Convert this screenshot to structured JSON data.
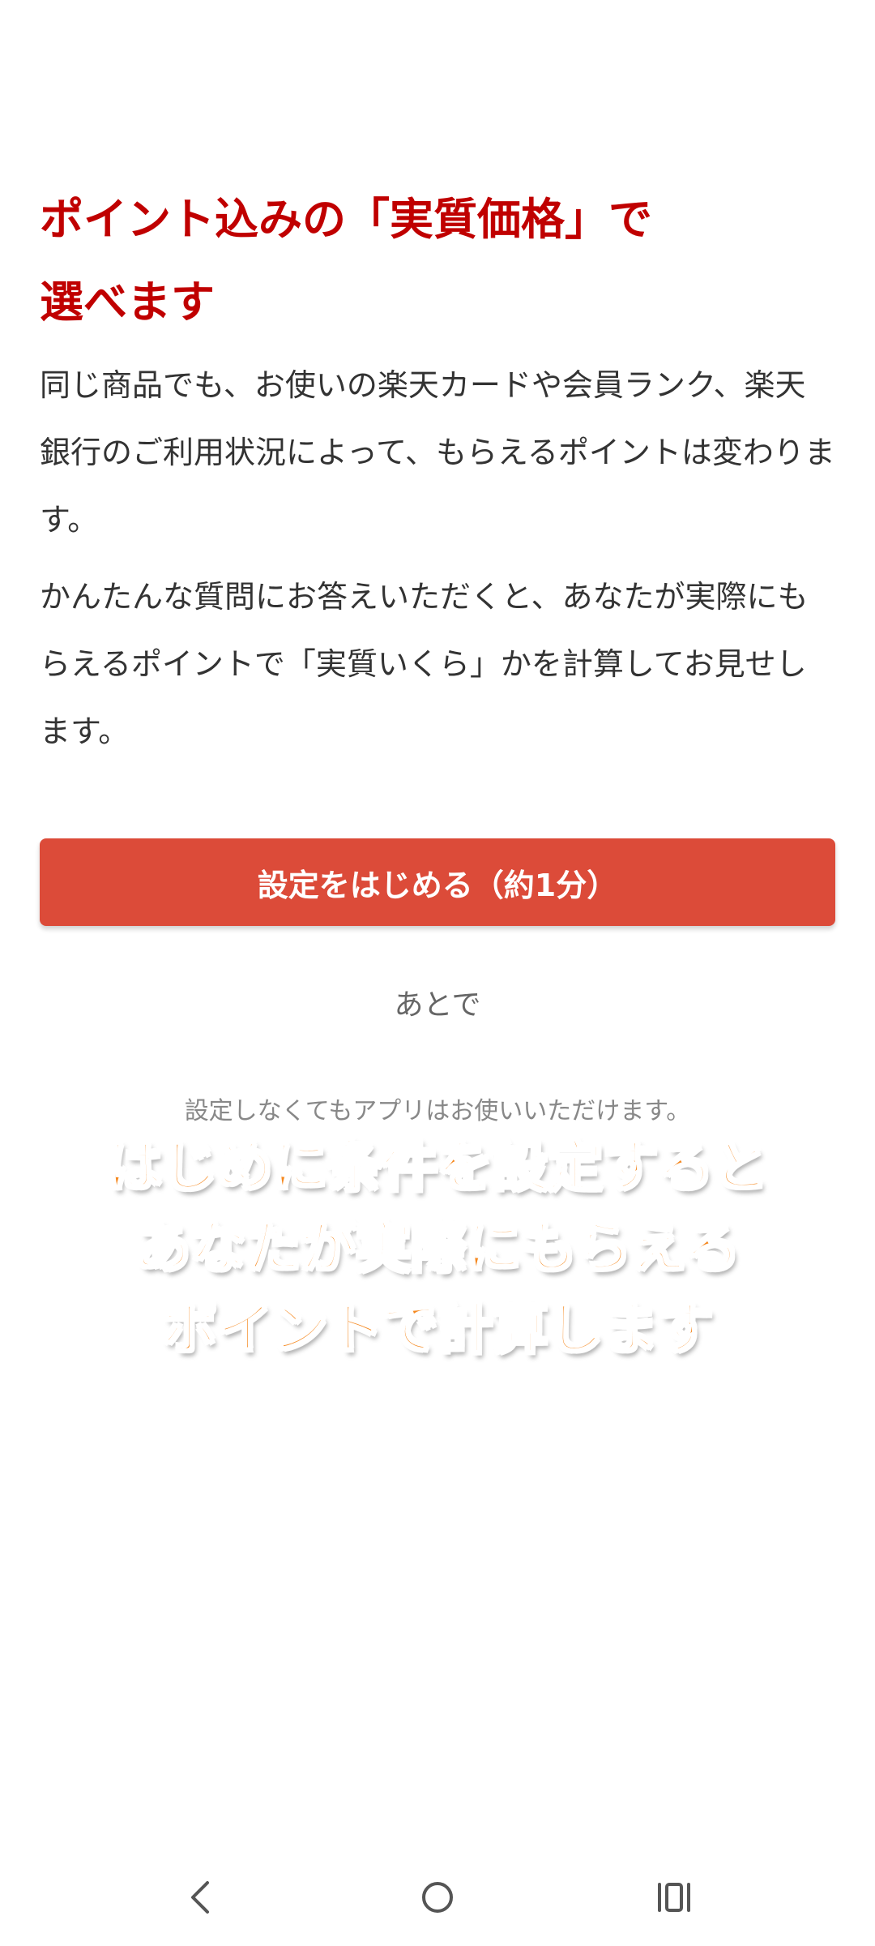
{
  "intro": {
    "headline_line1": "ポイント込みの「実質価格」で",
    "headline_line2": "選べます",
    "paragraph1": "同じ商品でも、お使いの楽天カードや会員ランク、楽天銀行のご利用状況によって、もらえるポイントは変わります。",
    "paragraph2": "かんたんな質問にお答えいただくと、あなたが実際にもらえるポイントで「実質いくら」かを計算してお見せします。"
  },
  "actions": {
    "start_label": "設定をはじめる（約1分）",
    "later_label": "あとで"
  },
  "note": "設定しなくてもアプリはお使いいただけます。",
  "overlay_caption": {
    "line1": "はじめに条件を設定すると",
    "line2": "あなたが実際にもらえる",
    "line3": "ポイントで計算します"
  },
  "navigation": {
    "icons": [
      "back-icon",
      "home-icon",
      "recents-icon"
    ]
  },
  "colors": {
    "headline": "#c00000",
    "primary_button": "#dc4b39",
    "overlay_text": "#f5881f"
  }
}
